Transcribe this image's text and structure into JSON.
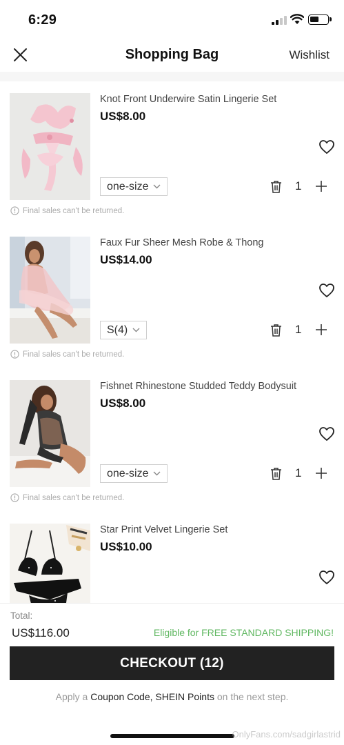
{
  "status_bar": {
    "time": "6:29"
  },
  "header": {
    "title": "Shopping Bag",
    "wishlist_label": "Wishlist"
  },
  "items": [
    {
      "name": "Knot Front Underwire Satin Lingerie Set",
      "price": "US$8.00",
      "size": "one-size",
      "quantity": "1",
      "note": "Final sales can't be returned."
    },
    {
      "name": "Faux Fur Sheer Mesh Robe & Thong",
      "price": "US$14.00",
      "size": "S(4)",
      "quantity": "1",
      "note": "Final sales can't be returned."
    },
    {
      "name": "Fishnet Rhinestone Studded Teddy Bodysuit",
      "price": "US$8.00",
      "size": "one-size",
      "quantity": "1",
      "note": "Final sales can't be returned."
    },
    {
      "name": "Star Print Velvet Lingerie Set",
      "price": "US$10.00"
    }
  ],
  "footer": {
    "total_label": "Total:",
    "total_value": "US$116.00",
    "shipping_note": "Eligible for FREE STANDARD SHIPPING!",
    "checkout_label": "CHECKOUT (12)",
    "coupon_prefix": "Apply a",
    "coupon_highlight": "Coupon Code, SHEIN Points",
    "coupon_suffix": "on the next step."
  },
  "watermark": "OnlyFans.com/sadgirlastrid",
  "colors": {
    "accent_green": "#5fb760",
    "checkout_bg": "#222222",
    "divider": "#f6f6f6"
  },
  "icons": [
    "close-icon",
    "heart-icon",
    "trash-icon",
    "plus-icon",
    "chevron-down-icon",
    "info-icon"
  ]
}
